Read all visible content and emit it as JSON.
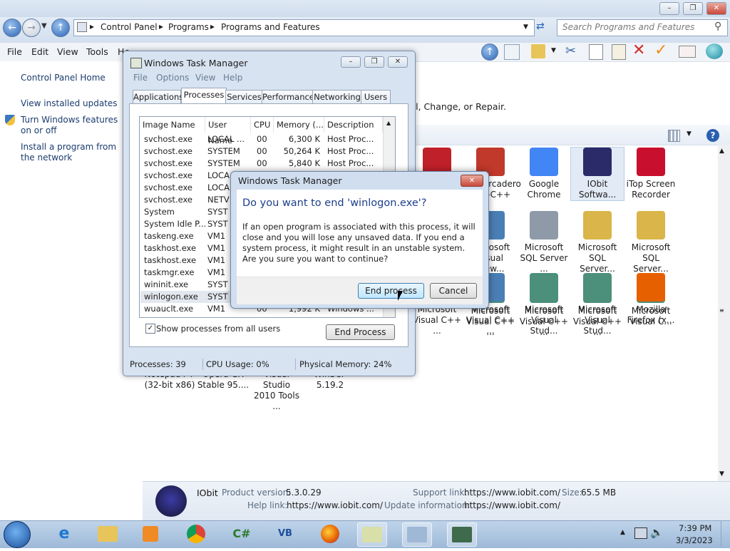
{
  "explorer": {
    "breadcrumb": [
      "Control Panel",
      "Programs",
      "Programs and Features"
    ],
    "search_placeholder": "Search Programs and Features",
    "menu": [
      "File",
      "Edit",
      "View",
      "Tools",
      "He"
    ],
    "left_pane": {
      "home": "Control Panel Home",
      "installed_updates": "View installed updates",
      "windows_features": "Turn Windows features on or off",
      "install_network": "Install a program from the network"
    },
    "uninstall_hint": "all, Change, or Repair.",
    "programs": [
      {
        "line1": "",
        "line2": "",
        "icon": "iobit-gear-icon",
        "color": "#c0202a"
      },
      {
        "line1": "Embarcadero",
        "line2": "Dev-C++",
        "icon": "devcpp-icon",
        "color": "#c0392b"
      },
      {
        "line1": "Google",
        "line2": "Chrome",
        "icon": "chrome-icon",
        "color": "#4285f4"
      },
      {
        "line1": "IObit",
        "line2": "Softwa...",
        "icon": "iobit-icon",
        "color": "#2b2b6a"
      },
      {
        "line1": "iTop Screen",
        "line2": "Recorder",
        "icon": "itop-recorder-icon",
        "color": "#c8102e"
      },
      {
        "line1": "Microsoft",
        "line2": "Visual View...",
        "icon": "installer-icon",
        "color": "#4a7fb5"
      },
      {
        "line1": "Microsoft",
        "line2": "SQL Server ...",
        "icon": "server-icon",
        "color": "#8e9aa8"
      },
      {
        "line1": "Microsoft",
        "line2": "SQL Server...",
        "icon": "installer-box-icon",
        "color": "#d9b54a"
      },
      {
        "line1": "Microsoft",
        "line2": "SQL Server...",
        "icon": "installer-box-icon",
        "color": "#d9b54a"
      },
      {
        "line1": "Microsoft",
        "line2": "Visual C++ ...",
        "icon": "vc-redist-icon",
        "color": "#4c8f7a"
      },
      {
        "line1": "Microsoft",
        "line2": "Visual C++ ...",
        "icon": "vc-redist-icon",
        "color": "#4c8f7a"
      },
      {
        "line1": "Microsoft",
        "line2": "Visual C++ ...",
        "icon": "vc-redist-icon",
        "color": "#4c8f7a"
      },
      {
        "line1": "Microsoft",
        "line2": "Visual C...",
        "icon": "vc-redist-icon",
        "color": "#4c8f7a"
      },
      {
        "line1": "Microsoft",
        "line2": "Visual C++ ...",
        "icon": "vc-redist-icon",
        "color": "#4c8f7a"
      },
      {
        "line1": "Microsoft",
        "line2": "Visual C++ ...",
        "icon": "vc-redist-icon",
        "color": "#4c8f7a"
      },
      {
        "line1": "Microsoft",
        "line2": "Visual C++ ...",
        "icon": "vc-redist-icon",
        "color": "#4c8f7a"
      },
      {
        "line1": "Microsoft",
        "line2": "Visual C++ ...",
        "icon": "vc-redist-icon",
        "color": "#4c8f7a"
      },
      {
        "line1": "Microsoft",
        "line2": "Visual C++ ...",
        "icon": "vc-redist-icon",
        "color": "#4c8f7a"
      },
      {
        "line1": "Microsoft",
        "line2": "Visual C++ ...",
        "icon": "vc-redist-icon",
        "color": "#4c8f7a"
      },
      {
        "line1": "Microsoft",
        "line2": "Visual C++ ...",
        "icon": "installer-cd-icon",
        "color": "#4a7fb5"
      },
      {
        "line1": "Microsoft",
        "line2": "Visual Stud...",
        "icon": "vs-icon",
        "color": "#4c8f7a"
      },
      {
        "line1": "Microsoft",
        "line2": "Visual Stud...",
        "icon": "vs-icon",
        "color": "#4c8f7a"
      },
      {
        "line1": "Mozilla",
        "line2": "Firefox (x...",
        "icon": "firefox-icon",
        "color": "#e66000"
      },
      {
        "line1": "Mozilla",
        "line2": "Maintenan...",
        "icon": "maintenance-icon",
        "color": "#5b8fc7"
      },
      {
        "line1": "Notepad++",
        "line2": "(32-bit x86)",
        "icon": "notepadpp-icon",
        "color": "#8dbf3d"
      },
      {
        "line1": "Opera GX",
        "line2": "Stable 95....",
        "icon": "opera-icon",
        "color": "#e0243c"
      },
      {
        "line1": "Visual Studio",
        "line2": "2010 Tools ...",
        "icon": "installer-box-icon",
        "color": "#d9b54a"
      },
      {
        "line1": "WinSCP",
        "line2": "5.19.2",
        "icon": "winscp-icon",
        "color": "#2f7a3d"
      }
    ],
    "details": {
      "name": "IObit",
      "product_version_label": "Product version:",
      "product_version": "5.3.0.29",
      "support_link_label": "Support link:",
      "support_link": "https://www.iobit.com/",
      "size_label": "Size:",
      "size": "65.5 MB",
      "help_link_label": "Help link:",
      "help_link": "https://www.iobit.com/",
      "update_info_label": "Update information:",
      "update_info": "https://www.iobit.com/"
    }
  },
  "task_manager": {
    "title": "Windows Task Manager",
    "menu": [
      "File",
      "Options",
      "View",
      "Help"
    ],
    "tabs": [
      "Applications",
      "Processes",
      "Services",
      "Performance",
      "Networking",
      "Users"
    ],
    "active_tab": "Processes",
    "columns": [
      "Image Name",
      "User Name",
      "CPU",
      "Memory (...",
      "Description"
    ],
    "rows": [
      [
        "svchost.exe",
        "LOCAL ...",
        "00",
        "6,300 K",
        "Host Proc..."
      ],
      [
        "svchost.exe",
        "SYSTEM",
        "00",
        "50,264 K",
        "Host Proc..."
      ],
      [
        "svchost.exe",
        "SYSTEM",
        "00",
        "5,840 K",
        "Host Proc..."
      ],
      [
        "svchost.exe",
        "LOCA",
        "",
        "",
        ""
      ],
      [
        "svchost.exe",
        "LOCA",
        "",
        "",
        ""
      ],
      [
        "svchost.exe",
        "NETV",
        "",
        "",
        ""
      ],
      [
        "System",
        "SYST",
        "",
        "",
        ""
      ],
      [
        "System Idle P...",
        "SYST",
        "",
        "",
        ""
      ],
      [
        "taskeng.exe",
        "VM1",
        "",
        "",
        ""
      ],
      [
        "taskhost.exe",
        "VM1",
        "",
        "",
        ""
      ],
      [
        "taskhost.exe",
        "VM1",
        "",
        "",
        ""
      ],
      [
        "taskmgr.exe",
        "VM1",
        "",
        "",
        ""
      ],
      [
        "wininit.exe",
        "SYST",
        "",
        "",
        ""
      ],
      [
        "winlogon.exe",
        "SYST",
        "",
        "",
        ""
      ],
      [
        "wuauclt.exe",
        "VM1",
        "00",
        "1,992 K",
        "Windows ..."
      ]
    ],
    "selected_row": 13,
    "show_all_label": "Show processes from all users",
    "end_process_label": "End Process",
    "status": {
      "processes": "Processes: 39",
      "cpu": "CPU Usage: 0%",
      "memory": "Physical Memory: 24%"
    }
  },
  "dialog": {
    "title": "Windows Task Manager",
    "heading": "Do you want to end 'winlogon.exe'?",
    "message": "If an open program is associated with this process, it will close and you will lose any unsaved data. If you end a system process, it might result in an unstable system. Are you sure you want to continue?",
    "end_label": "End process",
    "cancel_label": "Cancel"
  },
  "taskbar": {
    "time": "7:39 PM",
    "date": "3/3/2023"
  }
}
